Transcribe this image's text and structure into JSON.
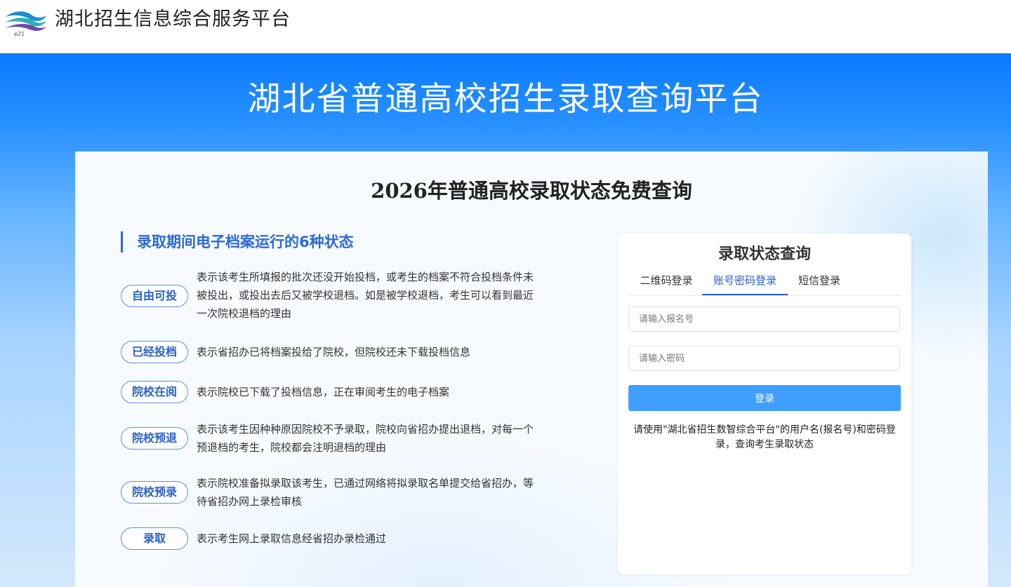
{
  "header": {
    "logo_text": "e21",
    "site_name": "湖北招生信息综合服务平台"
  },
  "hero": {
    "title": "湖北省普通高校招生录取查询平台"
  },
  "card": {
    "title": "2026年普通高校录取状态免费查询"
  },
  "section": {
    "heading": "录取期间电子档案运行的6种状态"
  },
  "statuses": [
    {
      "label": "自由可投",
      "desc": "表示该考生所填报的批次还没开始投档，或考生的档案不符合投档条件未被投出，或投出去后又被学校退档。如是被学校退档，考生可以看到最近一次院校退档的理由"
    },
    {
      "label": "已经投档",
      "desc": "表示省招办已将档案投给了院校，但院校还未下载投档信息"
    },
    {
      "label": "院校在阅",
      "desc": "表示院校已下载了投档信息，正在审阅考生的电子档案"
    },
    {
      "label": "院校预退",
      "desc": "表示该考生因种种原因院校不予录取，院校向省招办提出退档，对每一个预退档的考生，院校都会注明退档的理由"
    },
    {
      "label": "院校预录",
      "desc": "表示院校准备拟录取该考生，已通过网络将拟录取名单提交给省招办，等待省招办网上录检审核"
    },
    {
      "label": "录取",
      "desc": "表示考生网上录取信息经省招办录检通过"
    }
  ],
  "login": {
    "title": "录取状态查询",
    "tabs": [
      "二维码登录",
      "账号密码登录",
      "短信登录"
    ],
    "active_tab": "账号密码登录",
    "username": {
      "value": "",
      "placeholder": "请输入报名号"
    },
    "password": {
      "value": "",
      "placeholder": "请输入密码"
    },
    "submit_label": "登录",
    "tip": "请使用\"湖北省招生数智综合平台\"的用户名(报名号)和密码登录，查询考生录取状态"
  },
  "colors": {
    "brand_blue": "#2a5fc7",
    "button_blue": "#409eff",
    "banner_top": "#0a7bff"
  }
}
